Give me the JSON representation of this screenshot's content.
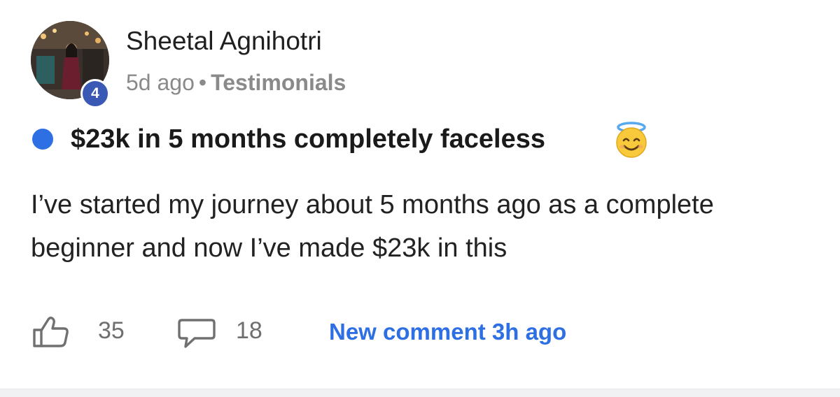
{
  "post": {
    "author": {
      "name": "Sheetal Agnihotri",
      "level": "4"
    },
    "meta": {
      "time": "5d ago",
      "separator": "•",
      "category": "Testimonials"
    },
    "title": "$23k in 5 months completely faceless",
    "title_emoji": "smiling-face-with-halo-icon",
    "body": "I’ve started my journey about 5 months ago as a complete beginner and now I’ve made $23k in this",
    "likes": "35",
    "comments": "18",
    "last_activity": "New comment 3h ago"
  },
  "colors": {
    "accent_blue": "#2f6fe4",
    "level_badge": "#3a59b5",
    "muted_text": "#8a8a8a"
  }
}
